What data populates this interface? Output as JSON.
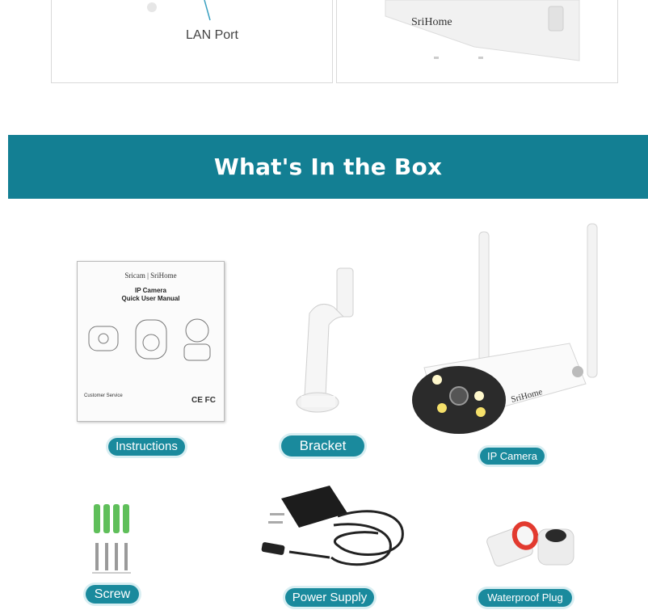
{
  "top_panels": {
    "lan_port_label": "LAN Port",
    "camera_brand": "SriHome"
  },
  "banner": {
    "title": "What's In the Box",
    "color": "#137f93"
  },
  "manual": {
    "brand": "Sricam | SriHome",
    "title_line1": "IP Camera",
    "title_line2": "Quick User Manual",
    "footer": "Customer Service",
    "marks": "CE FC"
  },
  "items": {
    "instructions": "Instructions",
    "bracket": "Bracket",
    "ip_camera": "IP Camera",
    "screw": "Screw",
    "power_supply": "Power Supply",
    "waterproof_plug": "Waterproof Plug"
  },
  "camera_logo": "SriHome"
}
